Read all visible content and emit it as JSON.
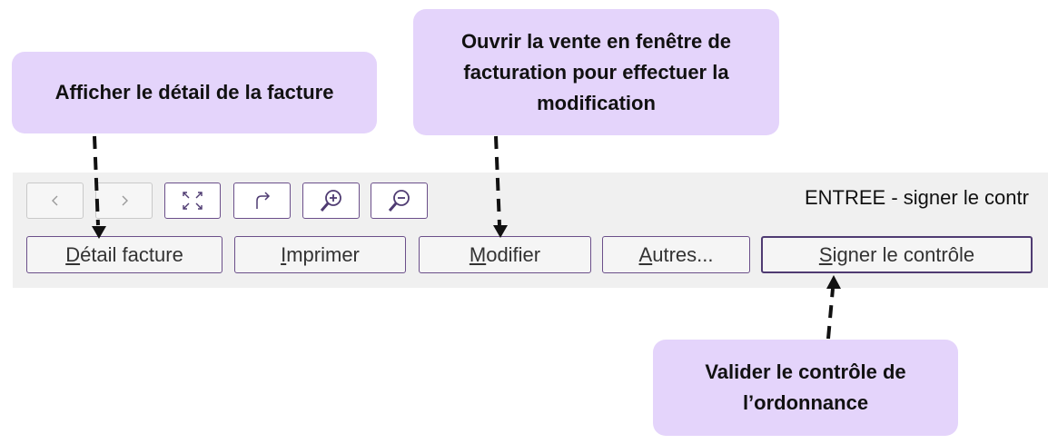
{
  "callouts": {
    "detail": "Afficher le détail de la facture",
    "modify_line1": "Ouvrir la vente en fenêtre de",
    "modify_line2": "facturation pour effectuer la",
    "modify_line3": "modification",
    "validate_line1": "Valider le contrôle de",
    "validate_line2": "l’ordonnance"
  },
  "toolbar": {
    "status_text": "ENTREE - signer le contr",
    "icons": [
      "chevron-left-icon",
      "chevron-right-icon",
      "fullscreen-icon",
      "redo-arrow-icon",
      "zoom-in-icon",
      "zoom-out-icon"
    ],
    "buttons": [
      {
        "accel": "D",
        "rest": "étail facture"
      },
      {
        "accel": "I",
        "rest": "mprimer"
      },
      {
        "accel": "M",
        "rest": "odifier"
      },
      {
        "accel": "A",
        "rest": "utres..."
      },
      {
        "accel": "S",
        "rest": "igner le contrôle"
      }
    ]
  },
  "colors": {
    "callout_bg": "#e4d4fb",
    "button_border": "#6b4f8a",
    "toolbar_bg": "#f0f0f0"
  }
}
